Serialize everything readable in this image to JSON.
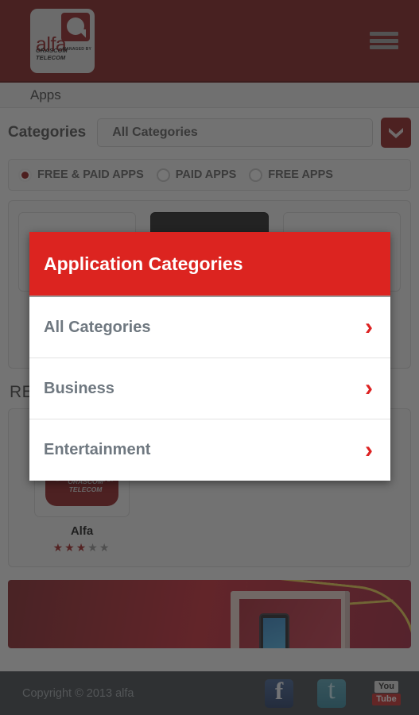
{
  "header": {
    "logo": {
      "brand": "alfa",
      "managed_by": "MANAGED BY",
      "parent": "ORASCOM TELECOM",
      "icon": "alfa-speech-bubble"
    },
    "menu_icon": "hamburger-menu-icon"
  },
  "breadcrumb": {
    "label": "Apps"
  },
  "filters": {
    "categories_label": "Categories",
    "selected_category": "All Categories",
    "dropdown_icon": "chevron-down-icon",
    "radios": [
      {
        "label": "FREE & PAID APPS",
        "selected": true
      },
      {
        "label": "PAID APPS",
        "selected": false
      },
      {
        "label": "FREE APPS",
        "selected": false
      }
    ]
  },
  "sections": {
    "recommended_title": "RE"
  },
  "apps": [
    {
      "name": "Alfa",
      "rating": 3,
      "rating_max": 5,
      "icon": "alfa-app-icon"
    }
  ],
  "modal": {
    "title": "Application Categories",
    "items": [
      {
        "label": "All Categories",
        "chevron": "chevron-right-icon"
      },
      {
        "label": "Business",
        "chevron": "chevron-right-icon"
      },
      {
        "label": "Entertainment",
        "chevron": "chevron-right-icon"
      }
    ]
  },
  "footer": {
    "copyright": "Copyright © 2013 alfa",
    "socials": [
      {
        "name": "facebook-icon",
        "glyph": "f"
      },
      {
        "name": "twitter-icon",
        "glyph": "t"
      },
      {
        "name": "youtube-icon",
        "top": "You",
        "bottom": "Tube"
      }
    ]
  },
  "colors": {
    "header_red": "#7d1515",
    "modal_red": "#dc2420",
    "accent_red": "#dd2222",
    "footer_gray": "#3a3f44"
  }
}
